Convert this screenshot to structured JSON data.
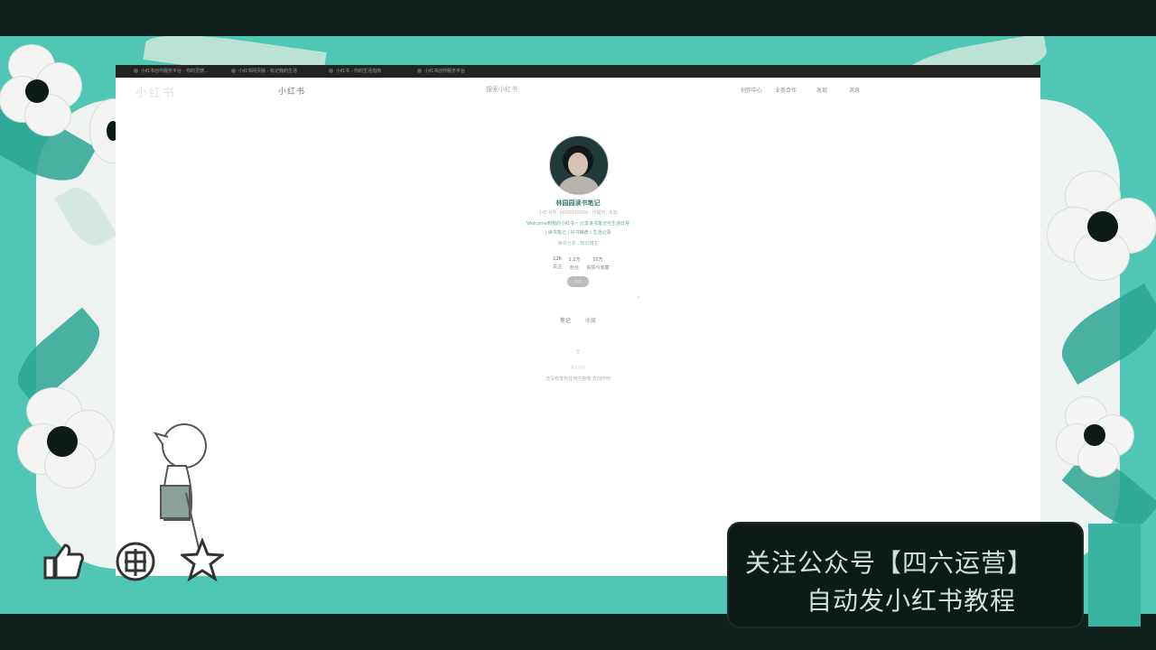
{
  "browser": {
    "tabs": [
      {
        "label": "小红书创作服务平台 - 你的灵感..."
      },
      {
        "label": "小红书网页版 - 标记我的生活"
      },
      {
        "label": "小红书 - 你的生活指南"
      },
      {
        "label": "小红书创作服务平台"
      }
    ]
  },
  "site": {
    "faint_logo": "小红书",
    "logo": "小红书",
    "search_placeholder": "搜索小红书",
    "nav": [
      "创作中心",
      "业务合作",
      "发现",
      "消息"
    ]
  },
  "profile": {
    "name": "林园园读书笔记",
    "id_line": "小红书号: 0000000000 · IP属地: 未知",
    "bio_line1": "Welcome到我的小红书~ 分享读书笔记与生活日常",
    "bio_line2": "| 读书笔记 | 好书推荐 | 生活记录",
    "tags_line": "读书分享 · 知识博主",
    "stats": [
      {
        "num": "126",
        "label": "关注"
      },
      {
        "num": "1.2万",
        "label": "粉丝"
      },
      {
        "num": "10万",
        "label": "获赞与收藏"
      }
    ],
    "follow_label": "关注"
  },
  "content_tabs": {
    "notes": "笔记",
    "collect": "收藏"
  },
  "empty_state": {
    "line1": "- 空 -",
    "line2": "暂无内容",
    "line3": "还没有发布任何内容哦 去创作吧"
  },
  "overlay": {
    "caption_line1": "关注公众号【四六运营】",
    "caption_line2": "自动发小红书教程"
  },
  "icons": [
    "like-icon",
    "coin-icon",
    "star-icon",
    "avatar-icon"
  ],
  "colors": {
    "frame": "#4fc7b4",
    "frame_light": "#eef3f1",
    "caption_bg": "#0e1a17",
    "caption_text": "#cfe0da",
    "accent": "#3b7f76"
  }
}
